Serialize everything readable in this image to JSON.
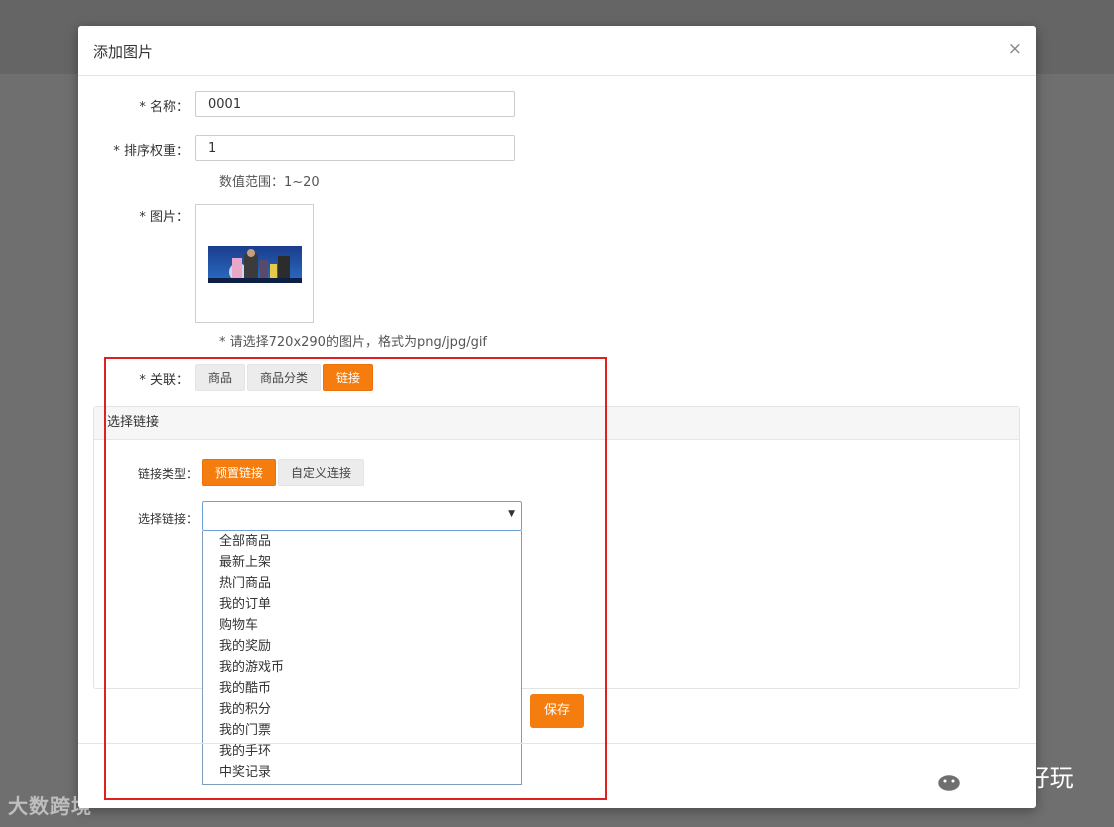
{
  "dialog": {
    "title": "添加图片",
    "close": "×"
  },
  "form": {
    "name_label": "* 名称：",
    "name_value": "0001",
    "sort_label": "* 排序权重：",
    "sort_value": "1",
    "sort_hint": "数值范围：1~20",
    "image_label": "* 图片：",
    "image_hint": "* 请选择720x290的图片，格式为png/jpg/gif",
    "relation_label": "* 关联：",
    "relation_options": [
      "商品",
      "商品分类",
      "链接"
    ],
    "relation_selected": "链接"
  },
  "link_panel": {
    "title": "选择链接",
    "type_label": "链接类型：",
    "type_options": [
      "预置链接",
      "自定义连接"
    ],
    "type_selected": "预置链接",
    "select_label": "选择链接：",
    "select_value": "",
    "dropdown_options": [
      "全部商品",
      "最新上架",
      "热门商品",
      "我的订单",
      "购物车",
      "我的奖励",
      "我的游戏币",
      "我的酷币",
      "我的积分",
      "我的门票",
      "我的手环",
      "中奖记录"
    ]
  },
  "actions": {
    "save": "保存"
  },
  "watermarks": {
    "left": "大数跨境",
    "right": "好酷好玩"
  },
  "colors": {
    "accent": "#f57c0f",
    "highlight_box": "#e02020",
    "overlay": "#6f6f6f"
  }
}
